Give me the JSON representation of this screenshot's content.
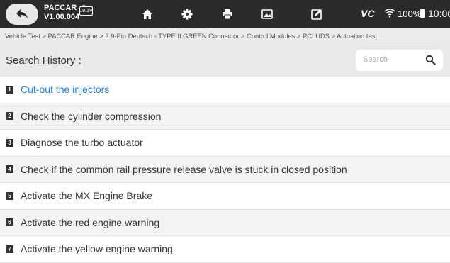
{
  "topbar": {
    "vehicle_name": "PACCAR",
    "version": "V1.00.004",
    "battery_voltage": "19.1V",
    "vci_label": "VC",
    "battery_percent": "100%",
    "time": "10:06",
    "icons": [
      "back-arrow-icon",
      "home-icon",
      "settings-icon",
      "print-icon",
      "screenshot-icon",
      "edit-icon",
      "wifi-icon",
      "battery-icon"
    ]
  },
  "breadcrumb": "Vehicle Test > PACCAR Engine > 2.9-Pin Deutsch - TYPE II GREEN Connector > Control Modules > PCI UDS > Actuation test",
  "search": {
    "title": "Search History :",
    "placeholder": "Search"
  },
  "items": [
    {
      "num": "1",
      "label": "Cut-out the injectors"
    },
    {
      "num": "2",
      "label": "Check the cylinder compression"
    },
    {
      "num": "3",
      "label": "Diagnose the turbo actuator"
    },
    {
      "num": "4",
      "label": "Check if the common rail pressure release valve is stuck in closed position"
    },
    {
      "num": "5",
      "label": "Activate the MX Engine Brake"
    },
    {
      "num": "6",
      "label": "Activate the red engine warning"
    },
    {
      "num": "7",
      "label": "Activate the yellow engine warning"
    }
  ],
  "colors": {
    "active_item": "#2a83d8",
    "topbar_bg": "#2b2b2b"
  }
}
